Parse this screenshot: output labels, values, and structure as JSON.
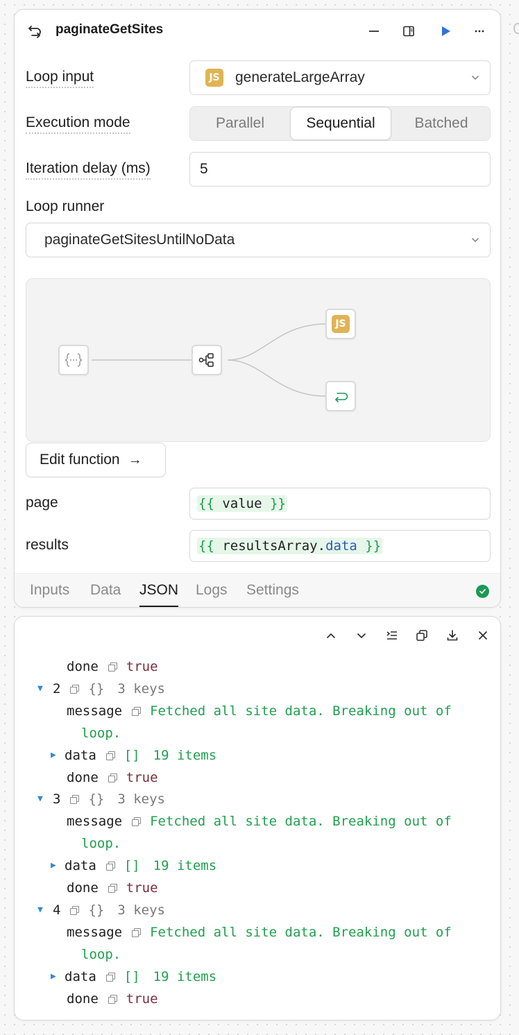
{
  "header": {
    "title": "paginateGetSites"
  },
  "form": {
    "loop_input_label": "Loop input",
    "loop_input_value": "generateLargeArray",
    "loop_input_badge": "JS",
    "execution_mode_label": "Execution mode",
    "execution_modes": [
      "Parallel",
      "Sequential",
      "Batched"
    ],
    "execution_mode_selected": "Sequential",
    "iteration_delay_label": "Iteration delay (ms)",
    "iteration_delay_value": "5",
    "loop_runner_label": "Loop runner",
    "loop_runner_value": "paginateGetSitesUntilNoData",
    "edit_function_label": "Edit function",
    "params": [
      {
        "label": "page",
        "open": "{{ ",
        "ident": "value",
        "prop": "",
        "close": " }}"
      },
      {
        "label": "results",
        "open": "{{ ",
        "ident": "resultsArray",
        "prop": "data",
        "close": " }}"
      }
    ]
  },
  "graph": {
    "node_icons": [
      "braces-icon",
      "branch-icon",
      "js-icon",
      "return-icon"
    ],
    "js_badge": "JS"
  },
  "tabs": [
    "Inputs",
    "Data",
    "JSON",
    "Logs",
    "Settings"
  ],
  "active_tab": "JSON",
  "status_color": "#1a9a53",
  "json_view": {
    "lines": [
      {
        "indent": 1,
        "toggle": "",
        "key": "done",
        "type": "bool",
        "value": "true"
      },
      {
        "indent": 0,
        "toggle": "▼",
        "key": "2",
        "type": "meta",
        "value": "{}",
        "extra": "3 keys"
      },
      {
        "indent": 1,
        "toggle": "",
        "key": "message",
        "type": "str",
        "value": "Fetched all site data. Breaking out of"
      },
      {
        "indent": 2,
        "toggle": "",
        "key": "",
        "type": "cont",
        "value": "loop."
      },
      {
        "indent": 1,
        "toggle": "▶",
        "key": "data",
        "type": "arr",
        "value": "[]",
        "extra": "19 items"
      },
      {
        "indent": 1,
        "toggle": "",
        "key": "done",
        "type": "bool",
        "value": "true"
      },
      {
        "indent": 0,
        "toggle": "▼",
        "key": "3",
        "type": "meta",
        "value": "{}",
        "extra": "3 keys"
      },
      {
        "indent": 1,
        "toggle": "",
        "key": "message",
        "type": "str",
        "value": "Fetched all site data. Breaking out of"
      },
      {
        "indent": 2,
        "toggle": "",
        "key": "",
        "type": "cont",
        "value": "loop."
      },
      {
        "indent": 1,
        "toggle": "▶",
        "key": "data",
        "type": "arr",
        "value": "[]",
        "extra": "19 items"
      },
      {
        "indent": 1,
        "toggle": "",
        "key": "done",
        "type": "bool",
        "value": "true"
      },
      {
        "indent": 0,
        "toggle": "▼",
        "key": "4",
        "type": "meta",
        "value": "{}",
        "extra": "3 keys"
      },
      {
        "indent": 1,
        "toggle": "",
        "key": "message",
        "type": "str",
        "value": "Fetched all site data. Breaking out of"
      },
      {
        "indent": 2,
        "toggle": "",
        "key": "",
        "type": "cont",
        "value": "loop."
      },
      {
        "indent": 1,
        "toggle": "▶",
        "key": "data",
        "type": "arr",
        "value": "[]",
        "extra": "19 items"
      },
      {
        "indent": 1,
        "toggle": "",
        "key": "done",
        "type": "bool",
        "value": "true"
      }
    ]
  }
}
